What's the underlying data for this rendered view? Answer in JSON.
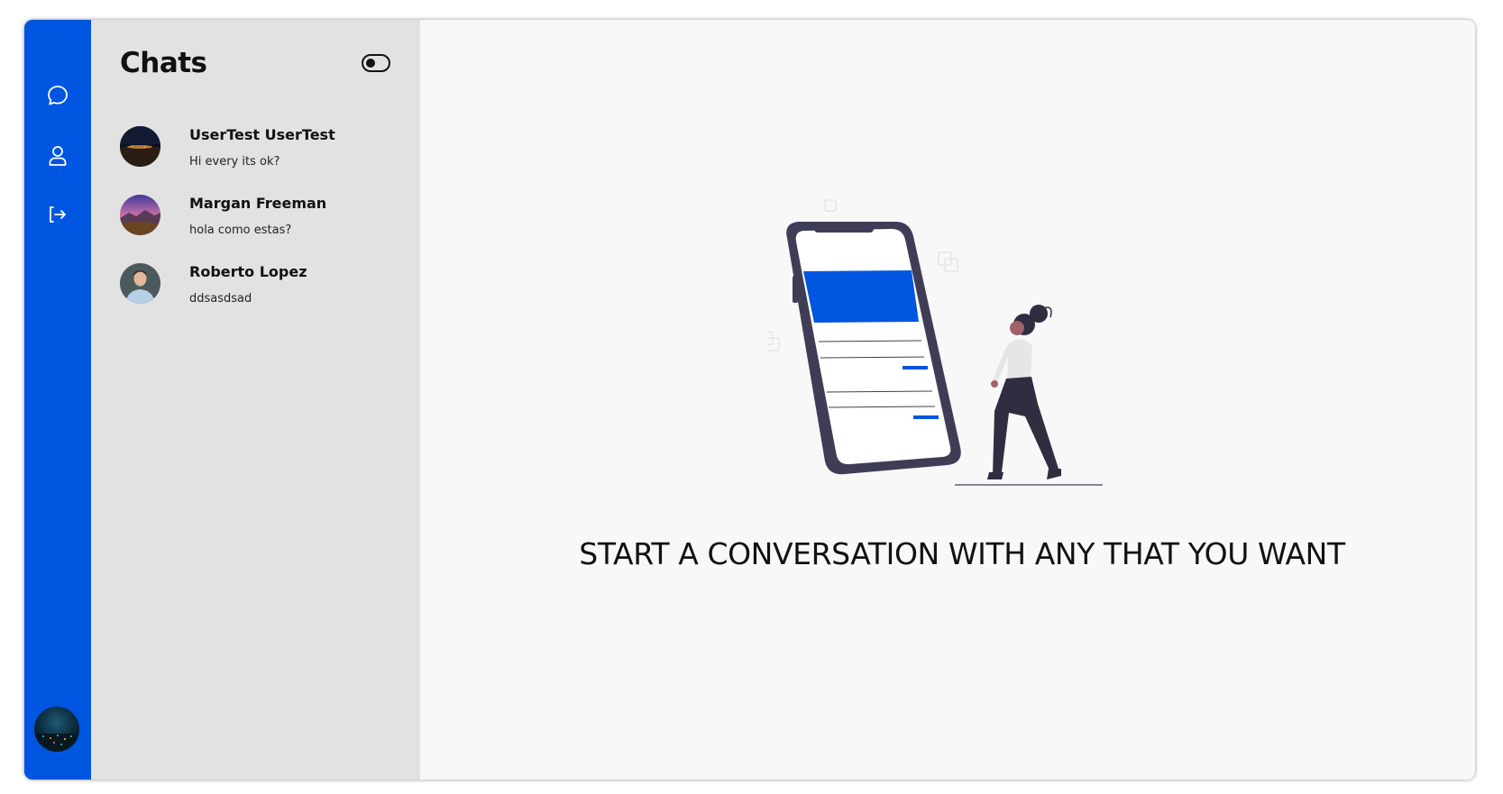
{
  "rail": {
    "items": [
      {
        "icon": "chat-bubble-icon",
        "label": "Chats"
      },
      {
        "icon": "user-icon",
        "label": "Profile"
      },
      {
        "icon": "logout-icon",
        "label": "Logout"
      }
    ],
    "accent_color": "#0056e0"
  },
  "sidebar": {
    "title": "Chats",
    "background": "#e2e2e2"
  },
  "chats": [
    {
      "name": "UserTest UserTest",
      "preview": "Hi every its ok?"
    },
    {
      "name": "Margan Freeman",
      "preview": "hola como estas?"
    },
    {
      "name": "Roberto Lopez",
      "preview": "ddsasdsad"
    }
  ],
  "main": {
    "headline": "START A CONVERSATION WITH ANY THAT YOU WANT"
  }
}
